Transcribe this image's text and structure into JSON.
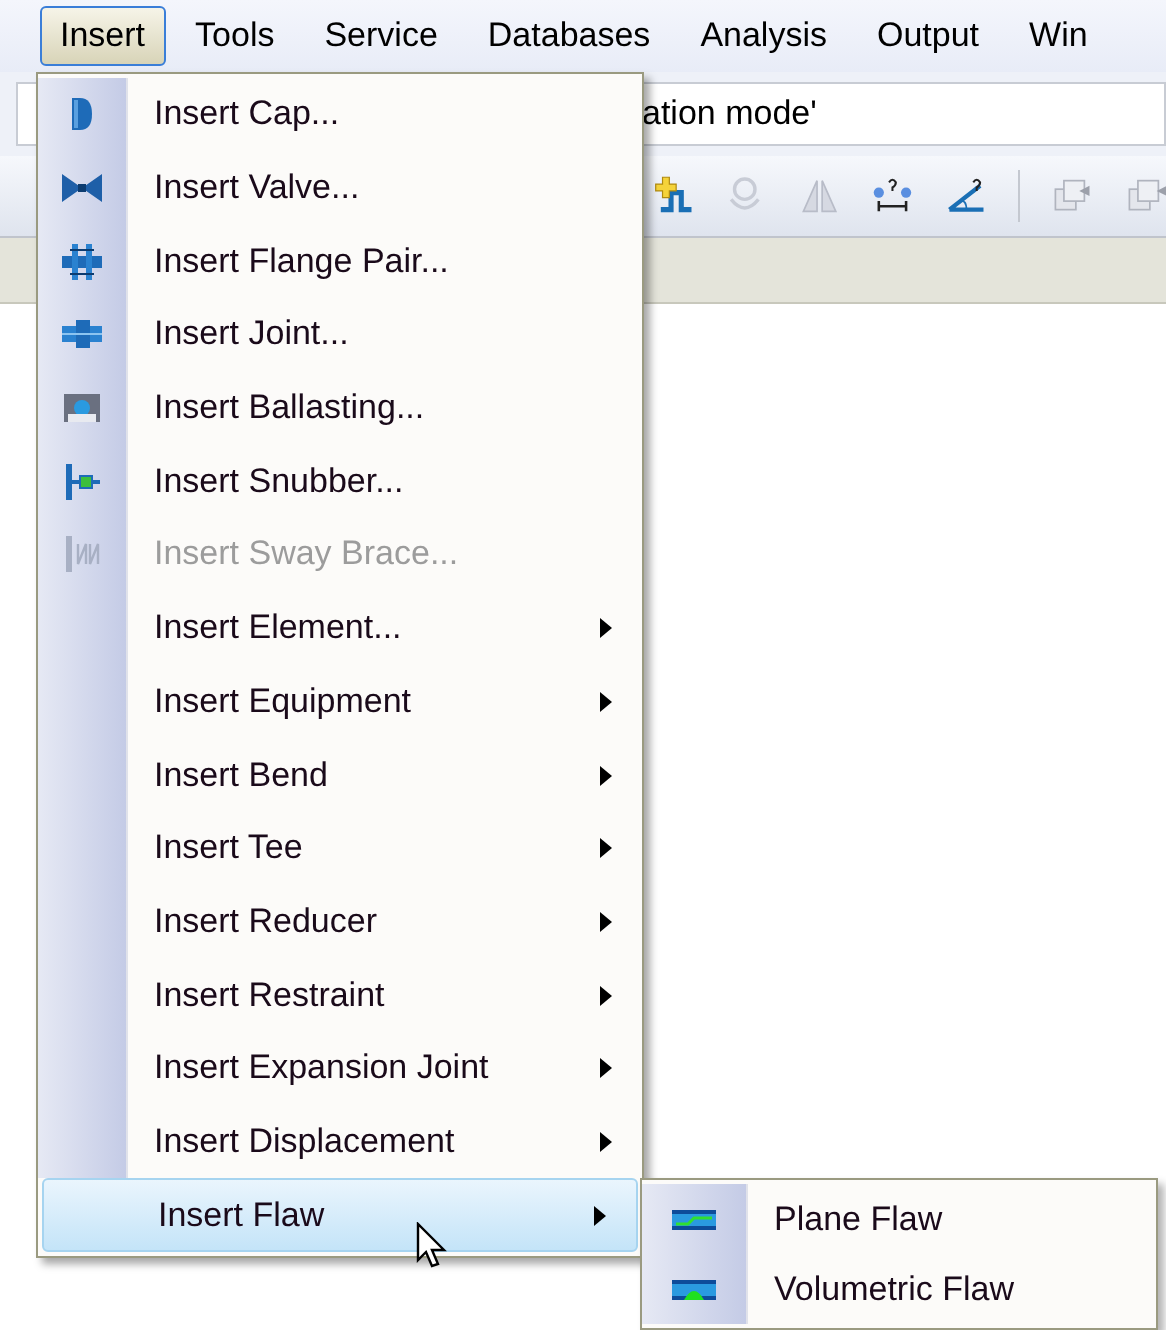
{
  "menu_bar": [
    {
      "label": "Insert",
      "selected": true
    },
    {
      "label": "Tools",
      "selected": false
    },
    {
      "label": "Service",
      "selected": false
    },
    {
      "label": "Databases",
      "selected": false
    },
    {
      "label": "Analysis",
      "selected": false
    },
    {
      "label": "Output",
      "selected": false
    },
    {
      "label": "Win",
      "selected": false
    }
  ],
  "mode_field": {
    "value": "ation mode'"
  },
  "menu": {
    "items": [
      {
        "label": "Insert Cap...",
        "disabled": false,
        "submenu": false,
        "selected": false
      },
      {
        "label": "Insert Valve...",
        "disabled": false,
        "submenu": false,
        "selected": false
      },
      {
        "label": "Insert Flange Pair...",
        "disabled": false,
        "submenu": false,
        "selected": false
      },
      {
        "label": "Insert Joint...",
        "disabled": false,
        "submenu": false,
        "selected": false
      },
      {
        "label": "Insert Ballasting...",
        "disabled": false,
        "submenu": false,
        "selected": false
      },
      {
        "label": "Insert Snubber...",
        "disabled": false,
        "submenu": false,
        "selected": false
      },
      {
        "label": "Insert Sway Brace...",
        "disabled": true,
        "submenu": false,
        "selected": false
      },
      {
        "label": "Insert Element...",
        "disabled": false,
        "submenu": true,
        "selected": false
      },
      {
        "label": "Insert Equipment",
        "disabled": false,
        "submenu": true,
        "selected": false
      },
      {
        "label": "Insert Bend",
        "disabled": false,
        "submenu": true,
        "selected": false
      },
      {
        "label": "Insert Tee",
        "disabled": false,
        "submenu": true,
        "selected": false
      },
      {
        "label": "Insert Reducer",
        "disabled": false,
        "submenu": true,
        "selected": false
      },
      {
        "label": "Insert Restraint",
        "disabled": false,
        "submenu": true,
        "selected": false
      },
      {
        "label": "Insert Expansion Joint",
        "disabled": false,
        "submenu": true,
        "selected": false
      },
      {
        "label": "Insert Displacement",
        "disabled": false,
        "submenu": true,
        "selected": false
      },
      {
        "label": "Insert Flaw",
        "disabled": false,
        "submenu": true,
        "selected": true
      }
    ]
  },
  "submenu": {
    "items": [
      {
        "label": "Plane Flaw"
      },
      {
        "label": "Volumetric Flaw"
      }
    ]
  }
}
